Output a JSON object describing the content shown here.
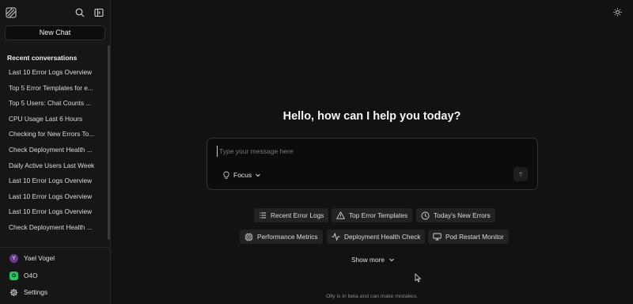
{
  "sidebar": {
    "new_chat_label": "New Chat",
    "recent_title": "Recent conversations",
    "conversations": [
      "Last 10 Error Logs Overview",
      "Top 5 Error Templates for e...",
      "Top 5 Users: Chat Counts ...",
      "CPU Usage Last 6 Hours",
      "Checking for New Errors To...",
      "Check Deployment Health ...",
      "Daily Active Users Last Week",
      "Last 10 Error Logs Overview",
      "Last 10 Error Logs Overview",
      "Last 10 Error Logs Overview",
      "Check Deployment Health ..."
    ],
    "user": {
      "initial": "Y",
      "name": "Yael Vogel"
    },
    "org": {
      "initial": "O",
      "name": "O4O"
    },
    "settings_label": "Settings"
  },
  "main": {
    "heading": "Hello, how can I help you today?",
    "input_placeholder": "Type your message here",
    "focus_label": "Focus",
    "suggestions": [
      {
        "label": "Recent Error Logs",
        "icon": "list-icon"
      },
      {
        "label": "Top Error Templates",
        "icon": "warning-icon"
      },
      {
        "label": "Today's New Errors",
        "icon": "clock-icon"
      },
      {
        "label": "Performance Metrics",
        "icon": "chip-icon"
      },
      {
        "label": "Deployment Health Check",
        "icon": "activity-icon"
      },
      {
        "label": "Pod Restart Monitor",
        "icon": "monitor-icon"
      }
    ],
    "show_more_label": "Show more",
    "footnote": "Olly is in beta and can make mistakes."
  },
  "colors": {
    "background": "#121212",
    "sidebar": "#161616",
    "chip": "#222222",
    "user_avatar": "#6a3a8a",
    "org_avatar": "#22c55e"
  }
}
